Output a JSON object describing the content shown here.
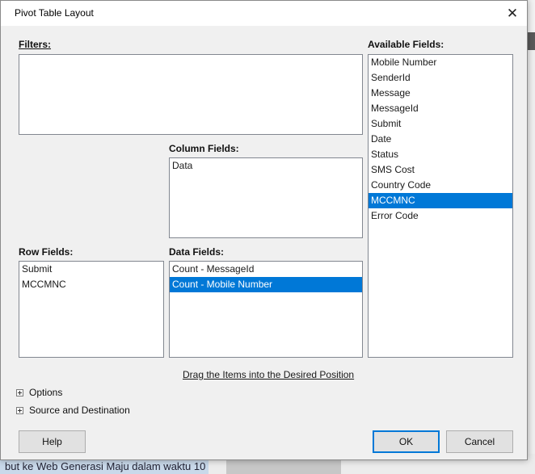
{
  "window": {
    "title": "Pivot Table Layout"
  },
  "labels": {
    "filters": "Filters:",
    "column_fields": "Column Fields:",
    "row_fields": "Row Fields:",
    "data_fields": "Data Fields:",
    "available_fields": "Available Fields:"
  },
  "column_fields": [
    "Data"
  ],
  "row_fields": [
    "Submit",
    "MCCMNC"
  ],
  "data_fields": [
    "Count - MessageId",
    "Count - Mobile Number"
  ],
  "data_fields_selected": "Count - Mobile Number",
  "available_fields": [
    "Mobile Number",
    "SenderId",
    "Message",
    "MessageId",
    "Submit",
    "Date",
    "Status",
    "SMS Cost",
    "Country Code",
    "MCCMNC",
    "Error Code"
  ],
  "available_selected": "MCCMNC",
  "drag_hint": "Drag the Items into the Desired Position",
  "expanders": {
    "options": "Options",
    "source": "Source and Destination"
  },
  "buttons": {
    "help": "Help",
    "ok": "OK",
    "cancel": "Cancel"
  },
  "background": {
    "bottom_text": "but ke Web Generasi Maju dalam waktu 10"
  },
  "colors": {
    "selection": "#0078d7",
    "dialog_bg": "#f0f0f0"
  }
}
